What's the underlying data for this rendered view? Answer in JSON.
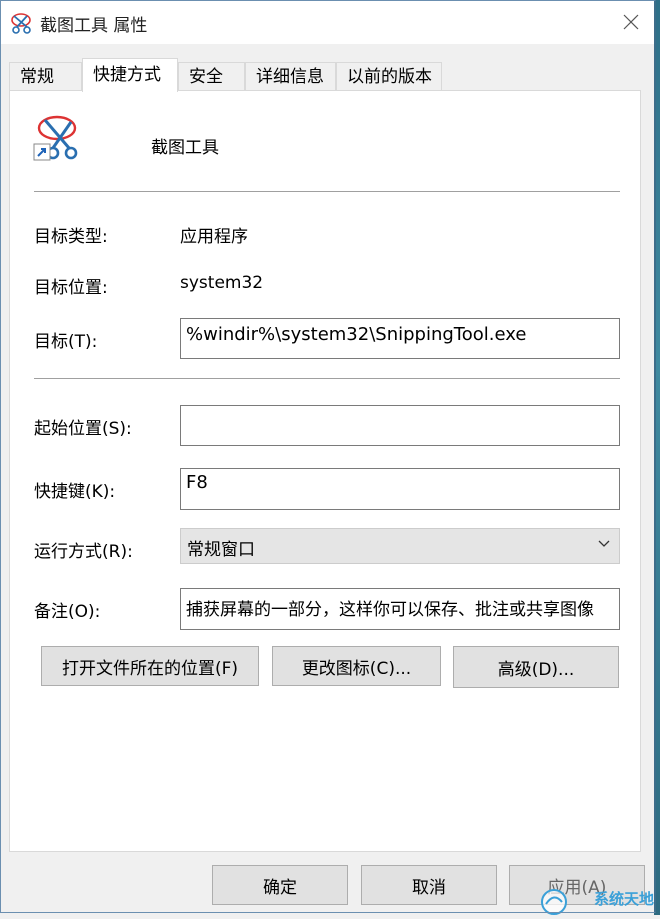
{
  "window": {
    "title": "截图工具 属性",
    "accent_color": "#0078d7"
  },
  "tabs": [
    {
      "label": "常规",
      "active": false
    },
    {
      "label": "快捷方式",
      "active": true
    },
    {
      "label": "安全",
      "active": false
    },
    {
      "label": "详细信息",
      "active": false
    },
    {
      "label": "以前的版本",
      "active": false
    }
  ],
  "app": {
    "name": "截图工具",
    "icon": "scissors-shortcut-icon"
  },
  "props": {
    "target_type_label": "目标类型:",
    "target_type_value": "应用程序",
    "target_location_label": "目标位置:",
    "target_location_value": "system32",
    "target_label": "目标(T):",
    "target_value": "%windir%\\system32\\SnippingTool.exe",
    "start_in_label": "起始位置(S):",
    "start_in_value": "",
    "shortcut_key_label": "快捷键(K):",
    "shortcut_key_value": "F8",
    "run_label": "运行方式(R):",
    "run_value": "常规窗口",
    "comment_label": "备注(O):",
    "comment_value": "捕获屏幕的一部分，这样你可以保存、批注或共享图像"
  },
  "actions": {
    "open_location": "打开文件所在的位置(F)",
    "change_icon": "更改图标(C)...",
    "advanced": "高级(D)..."
  },
  "footer": {
    "ok": "确定",
    "cancel": "取消",
    "apply": "应用(A)"
  },
  "watermark": {
    "text": "系统天地"
  }
}
